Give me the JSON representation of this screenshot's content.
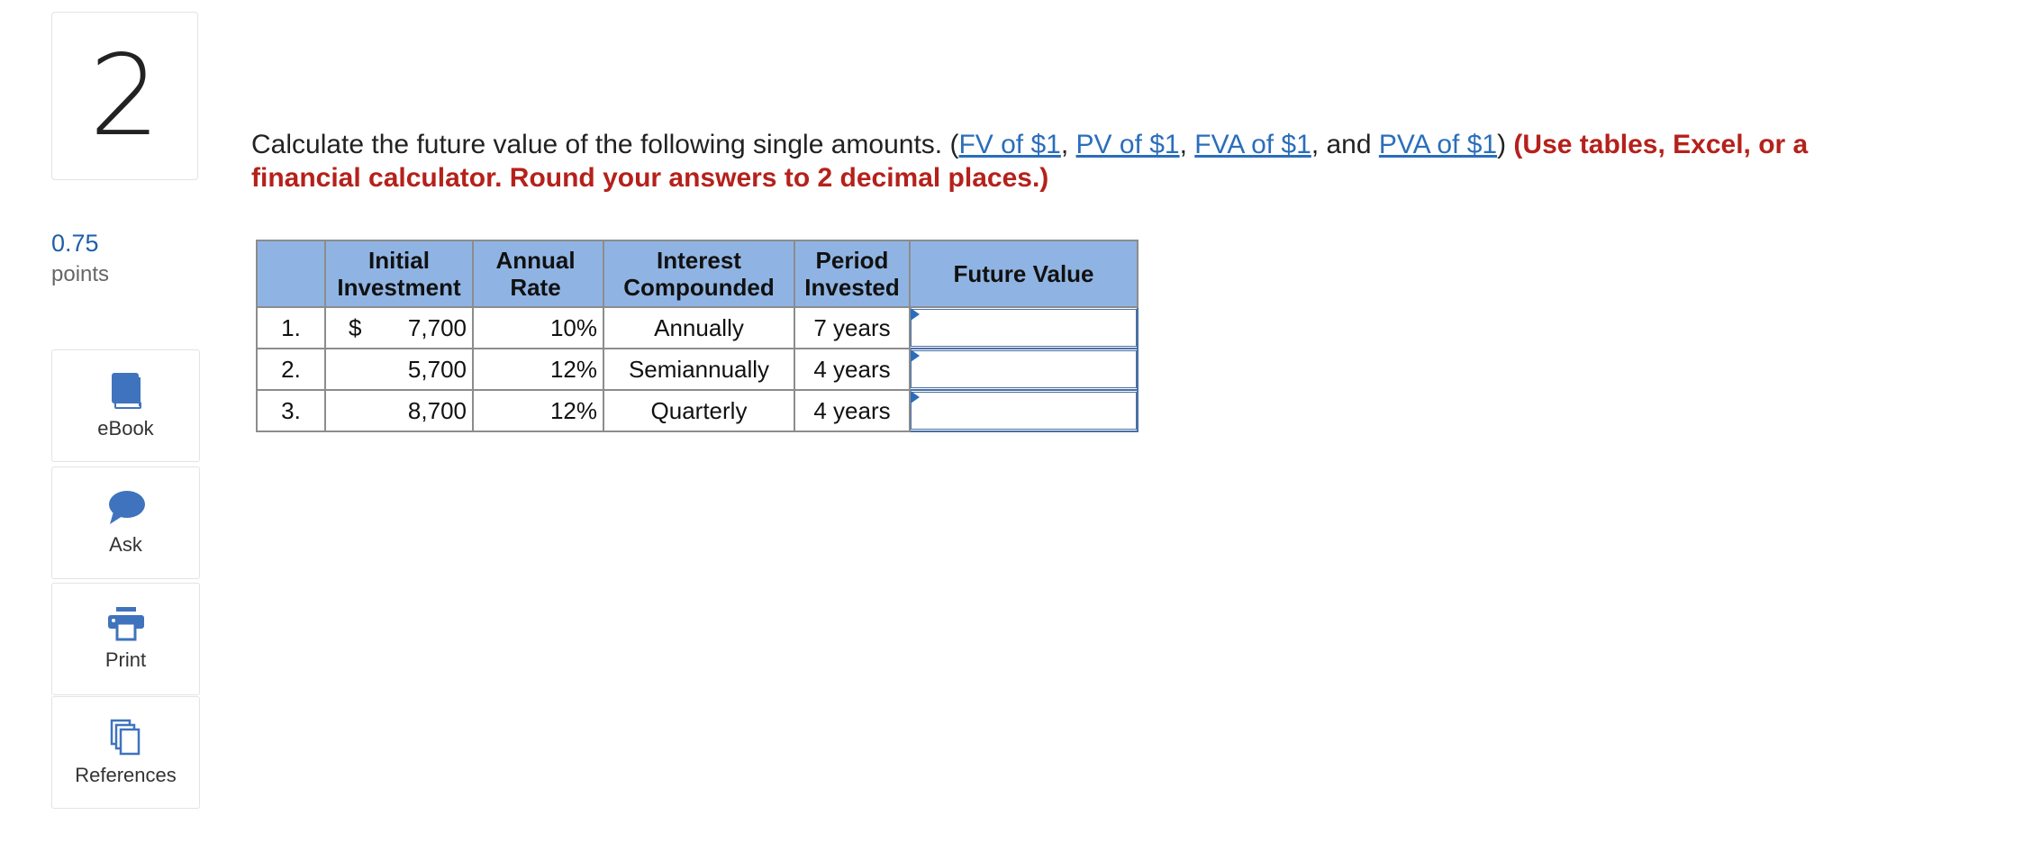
{
  "question": {
    "number": "2",
    "points_value": "0.75",
    "points_label": "points",
    "text_prefix": "Calculate the future value of the following single amounts. (",
    "links": [
      "FV of $1",
      "PV of $1",
      "FVA of $1",
      "PVA of $1"
    ],
    "sep1": ", ",
    "sep2": ", ",
    "sep3": ", and ",
    "close_paren": ") ",
    "instruction": "(Use tables, Excel, or a financial calculator. Round your answers to 2 decimal places.)"
  },
  "tools": [
    {
      "label": "eBook",
      "icon": "book-icon"
    },
    {
      "label": "Ask",
      "icon": "chat-bubble-icon"
    },
    {
      "label": "Print",
      "icon": "printer-icon"
    },
    {
      "label": "References",
      "icon": "documents-icon"
    }
  ],
  "table": {
    "headers": {
      "investment": [
        "Initial",
        "Investment"
      ],
      "rate": [
        "Annual",
        "Rate"
      ],
      "compounded": [
        "Interest",
        "Compounded"
      ],
      "period": [
        "Period",
        "Invested"
      ],
      "future_value": "Future Value"
    },
    "currency_symbol": "$",
    "rows": [
      {
        "index": "1.",
        "investment": "7,700",
        "rate": "10%",
        "compounded": "Annually",
        "period": "7 years",
        "future_value": ""
      },
      {
        "index": "2.",
        "investment": "5,700",
        "rate": "12%",
        "compounded": "Semiannually",
        "period": "4 years",
        "future_value": ""
      },
      {
        "index": "3.",
        "investment": "8,700",
        "rate": "12%",
        "compounded": "Quarterly",
        "period": "4 years",
        "future_value": ""
      }
    ]
  },
  "colors": {
    "header_bg": "#8fb4e3",
    "link": "#2a6ebb",
    "instruction": "#b5211b",
    "points": "#1f5fa8",
    "icon": "#3f73bd"
  }
}
